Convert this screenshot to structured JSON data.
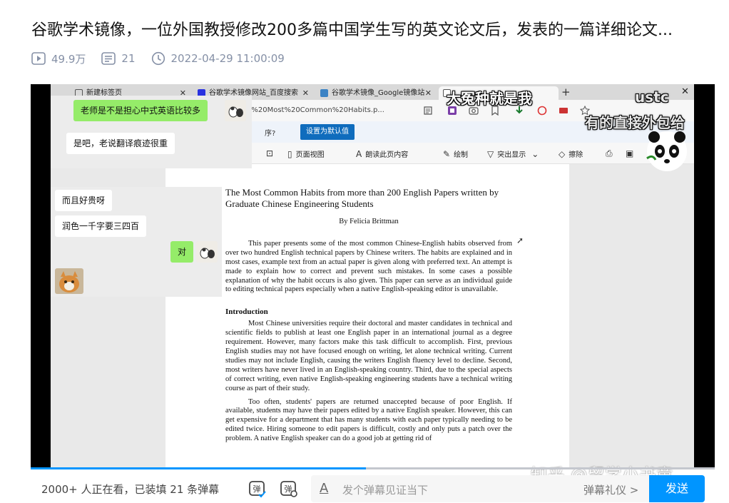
{
  "header": {
    "title": "谷歌学术镜像，一位外国教授修改200多篇中国学生写的英文论文后，发表的一篇详细论文...",
    "plays": "49.9万",
    "danmaku_count": "21",
    "date": "2022-04-29 11:00:09"
  },
  "browser": {
    "tabs": [
      {
        "label": "新建标签页"
      },
      {
        "label": "谷歌学术镜像网站_百度搜索"
      },
      {
        "label": "谷歌学术镜像_Google镜像站"
      },
      {
        "label": ""
      }
    ],
    "url": "ting/The%20Most%20Common%20Habits.p...",
    "prompt_question": "序?",
    "prompt_button": "设置为默认值",
    "toolbar": {
      "page_view": "页面视图",
      "read_aloud": "朗读此页内容",
      "draw": "绘制",
      "highlight": "突出显示",
      "erase": "擦除"
    }
  },
  "document": {
    "title": "The Most Common Habits from more than 200 English Papers written by Graduate Chinese Engineering Students",
    "author": "By Felicia Brittman",
    "abstract": "This paper presents some of the most common Chinese-English habits observed from over two hundred English technical papers by Chinese writers. The habits are explained and in most cases, example text from an actual paper is given along with preferred text. An attempt is made to explain how to correct and prevent such mistakes. In some cases a possible explanation of why the habit occurs is also given. This paper can serve as an individual guide to editing technical papers especially when a native English-speaking editor is unavailable.",
    "section_heading": "Introduction",
    "intro_p1": "Most Chinese universities require their doctoral and master candidates in technical and scientific fields to publish at least one English paper in an international journal as a degree requirement. However, many factors make this task difficult to accomplish. First, previous English studies may not have focused enough on writing, let alone technical writing. Current studies may not include English, causing the writers English fluency level to decline. Second, most writers have never lived in an English-speaking country. Third, due to the special aspects of correct writing, even native English-speaking engineering students have a technical writing course as part of their study.",
    "intro_p2": "Too often, students' papers are returned unaccepted because of poor English. If available, students may have their papers edited by a native English speaker. However, this can get expensive for a department that has many students with each paper typically needing to be edited twice. Hiring someone to edit papers is difficult, costly and only puts a patch over the problem. A native English speaker can do a good job at getting rid of"
  },
  "chat": {
    "messages": [
      {
        "text": "老师是不是担心中式英语比较多",
        "side": "right"
      },
      {
        "text": "是吧，老说翻译痕迹很重",
        "side": "left"
      },
      {
        "text": "而且好贵呀",
        "side": "left"
      },
      {
        "text": "润色一千字要三四百",
        "side": "left"
      },
      {
        "text": "对",
        "side": "right"
      }
    ]
  },
  "danmaku": {
    "d1": "大冤种就是我",
    "d2": "ustc",
    "d3": "有的直接外包给"
  },
  "watermark": "知乎 @留学小书童",
  "player": {
    "progress": 0.49
  },
  "bottom_bar": {
    "viewers": "2000+ 人正在看，已装填 21 条弹幕",
    "placeholder": "发个弹幕见证当下",
    "gift": "弹幕礼仪 >",
    "send": "发送"
  },
  "colors": {
    "accent": "#0095ff",
    "chat_green": "#95ec69",
    "edge_blue": "#0f6cbd"
  }
}
